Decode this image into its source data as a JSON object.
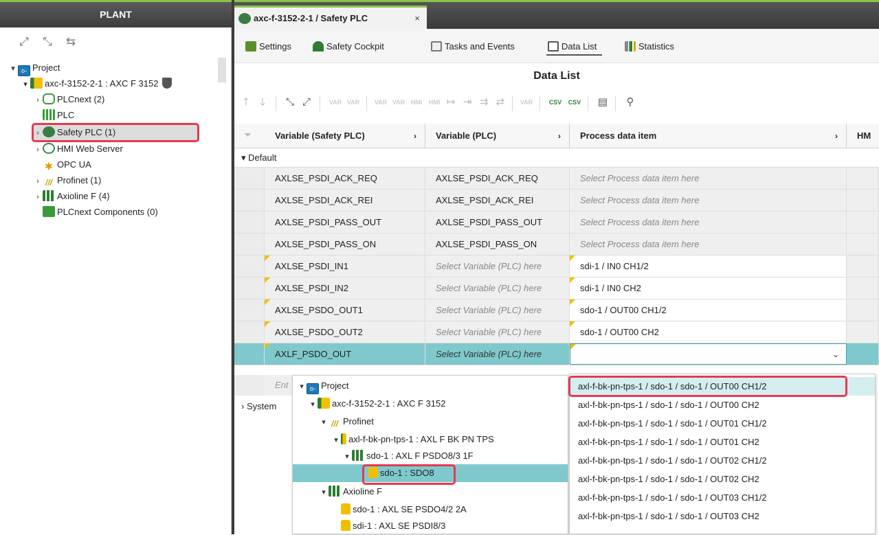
{
  "plant": {
    "title": "PLANT",
    "tree": [
      {
        "label": "Project"
      },
      {
        "label": "axc-f-3152-2-1 : AXC F 3152"
      },
      {
        "label": "PLCnext (2)"
      },
      {
        "label": "PLC"
      },
      {
        "label": "Safety PLC (1)"
      },
      {
        "label": "HMI Web Server"
      },
      {
        "label": "OPC UA"
      },
      {
        "label": "Profinet (1)"
      },
      {
        "label": "Axioline F (4)"
      },
      {
        "label": "PLCnext Components (0)"
      }
    ]
  },
  "doc_tab": {
    "title": "axc-f-3152-2-1 / Safety PLC",
    "close": "×"
  },
  "subtabs": [
    {
      "label": "Settings"
    },
    {
      "label": "Safety Cockpit"
    },
    {
      "label": "Tasks and Events"
    },
    {
      "label": "Data List"
    },
    {
      "label": "Statistics"
    }
  ],
  "datalist": {
    "title": "Data List",
    "toolbar": {
      "var": "VAR",
      "hmi": "HMI",
      "csv": "CSV"
    },
    "columns": [
      "Variable (Safety PLC)",
      "Variable (PLC)",
      "Process data item",
      "HM"
    ],
    "groups": {
      "default": "Default",
      "system": "System"
    },
    "rows": [
      {
        "safety": "AXLSE_PSDI_ACK_REQ",
        "plc": "AXLSE_PSDI_ACK_REQ",
        "process": "Select Process data item here"
      },
      {
        "safety": "AXLSE_PSDI_ACK_REI",
        "plc": "AXLSE_PSDI_ACK_REI",
        "process": "Select Process data item here"
      },
      {
        "safety": "AXLSE_PSDI_PASS_OUT",
        "plc": "AXLSE_PSDI_PASS_OUT",
        "process": "Select Process data item here"
      },
      {
        "safety": "AXLSE_PSDI_PASS_ON",
        "plc": "AXLSE_PSDI_PASS_ON",
        "process": "Select Process data item here"
      },
      {
        "safety": "AXLSE_PSDI_IN1",
        "plc": "Select Variable (PLC) here",
        "process": "sdi-1 / IN0 CH1/2"
      },
      {
        "safety": "AXLSE_PSDI_IN2",
        "plc": "Select Variable (PLC) here",
        "process": "sdi-1 / IN0 CH2"
      },
      {
        "safety": "AXLSE_PSDO_OUT1",
        "plc": "Select Variable (PLC) here",
        "process": "sdo-1 / OUT00 CH1/2"
      },
      {
        "safety": "AXLSE_PSDO_OUT2",
        "plc": "Select Variable (PLC) here",
        "process": "sdo-1 / OUT00 CH2"
      },
      {
        "safety": "AXLF_PSDO_OUT",
        "plc": "Select Variable (PLC) here",
        "process": ""
      }
    ],
    "enter_row": "Ent"
  },
  "popup_tree": [
    {
      "label": "Project"
    },
    {
      "label": "axc-f-3152-2-1 : AXC F 3152"
    },
    {
      "label": "Profinet"
    },
    {
      "label": "axl-f-bk-pn-tps-1 : AXL F BK PN TPS"
    },
    {
      "label": "sdo-1 : AXL F PSDO8/3 1F"
    },
    {
      "label": "sdo-1 : SDO8"
    },
    {
      "label": "Axioline F"
    },
    {
      "label": "sdo-1 : AXL SE PSDO4/2 2A"
    },
    {
      "label": "sdi-1 : AXL SE PSDI8/3"
    }
  ],
  "popup_list": [
    "axl-f-bk-pn-tps-1 / sdo-1 / sdo-1 / OUT00 CH1/2",
    "axl-f-bk-pn-tps-1 / sdo-1 / sdo-1 / OUT00 CH2",
    "axl-f-bk-pn-tps-1 / sdo-1 / sdo-1 / OUT01 CH1/2",
    "axl-f-bk-pn-tps-1 / sdo-1 / sdo-1 / OUT01 CH2",
    "axl-f-bk-pn-tps-1 / sdo-1 / sdo-1 / OUT02 CH1/2",
    "axl-f-bk-pn-tps-1 / sdo-1 / sdo-1 / OUT02 CH2",
    "axl-f-bk-pn-tps-1 / sdo-1 / sdo-1 / OUT03 CH1/2",
    "axl-f-bk-pn-tps-1 / sdo-1 / sdo-1 / OUT03 CH2"
  ],
  "colors": {
    "accent": "#8bc34a",
    "selection": "#7fc9cd",
    "highlight": "#e53950"
  }
}
